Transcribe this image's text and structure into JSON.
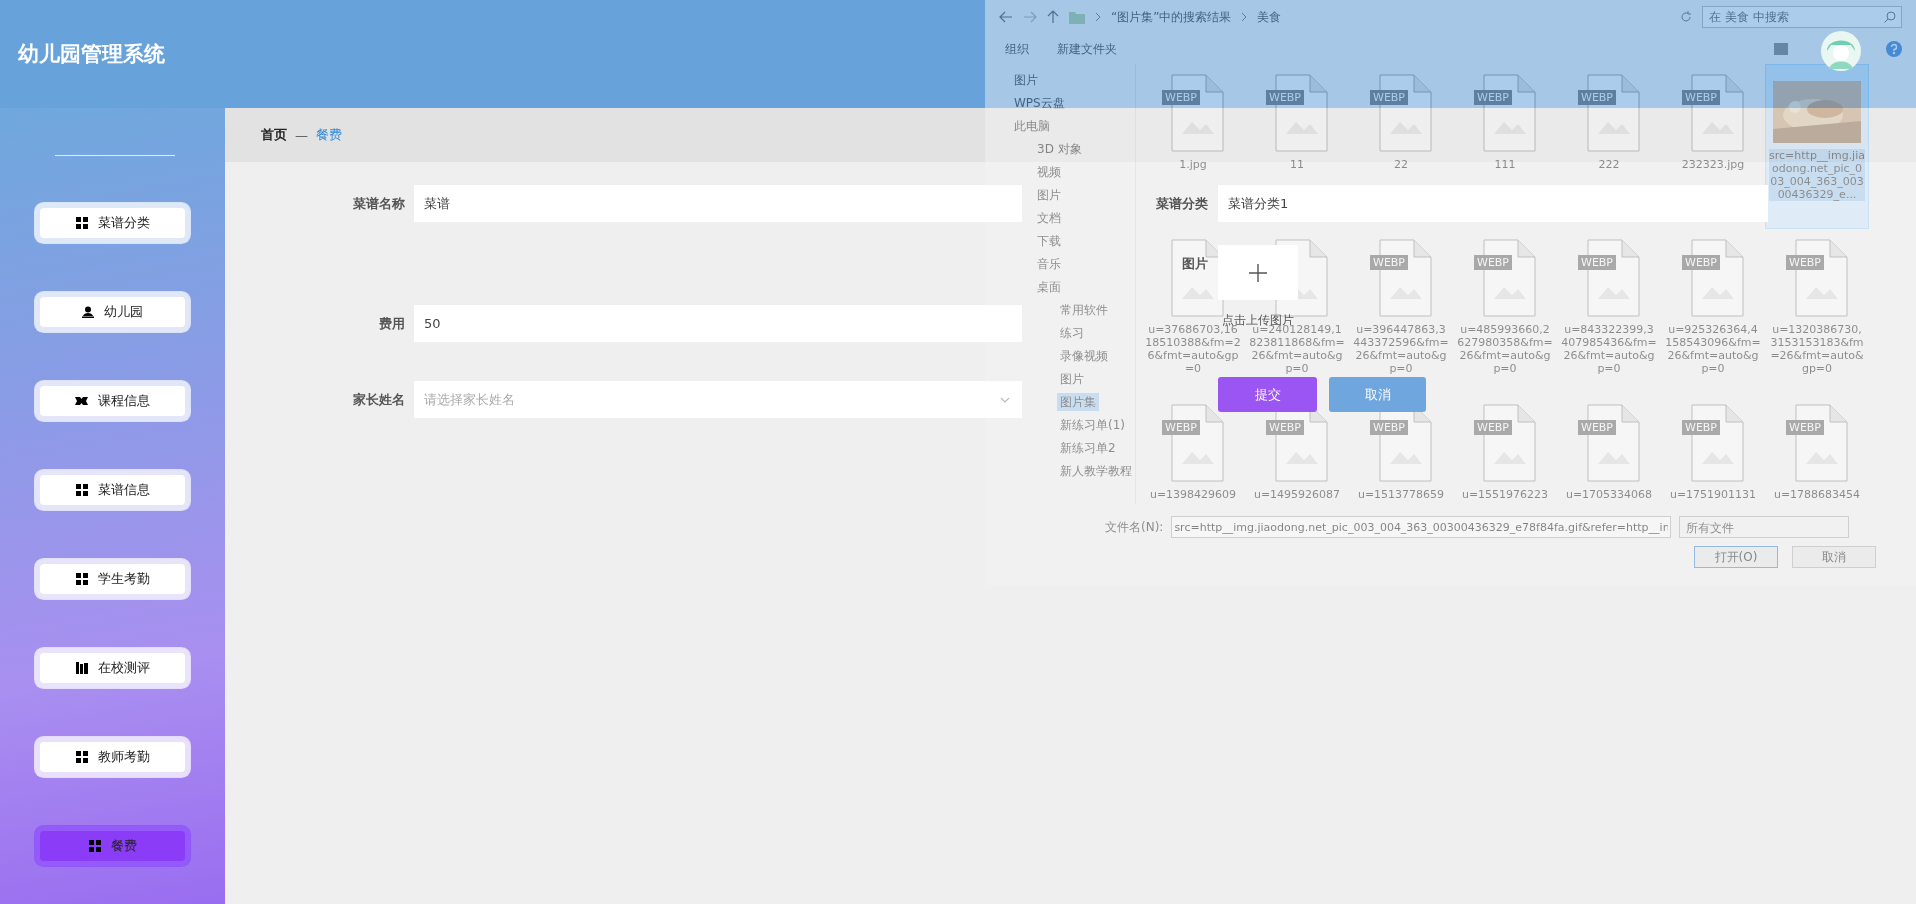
{
  "header": {
    "title": "幼儿园管理系统"
  },
  "sidebar": {
    "items": [
      {
        "label": "菜谱分类",
        "kind": "grid",
        "selected": false
      },
      {
        "label": "幼儿园",
        "kind": "person",
        "selected": false
      },
      {
        "label": "课程信息",
        "kind": "ticket",
        "selected": false
      },
      {
        "label": "菜谱信息",
        "kind": "grid",
        "selected": false
      },
      {
        "label": "学生考勤",
        "kind": "grid",
        "selected": false
      },
      {
        "label": "在校测评",
        "kind": "books",
        "selected": false
      },
      {
        "label": "教师考勤",
        "kind": "grid",
        "selected": false
      },
      {
        "label": "餐费",
        "kind": "grid",
        "selected": true
      }
    ]
  },
  "breadcrumb": {
    "home": "首页",
    "separator": "—",
    "current": "餐费"
  },
  "form": {
    "left": [
      {
        "label": "菜谱名称",
        "kind": "text",
        "value": "菜谱"
      },
      {
        "label": "费用",
        "kind": "text",
        "value": "50"
      },
      {
        "label": "家长姓名",
        "kind": "select",
        "placeholder": "请选择家长姓名"
      }
    ],
    "category": {
      "label": "菜谱分类",
      "value": "菜谱分类1"
    },
    "upload": {
      "label": "图片",
      "hint": "点击上传图片"
    },
    "buttons": [
      {
        "label": "提交",
        "kind": "primary"
      },
      {
        "label": "取消",
        "kind": "secondary"
      }
    ]
  },
  "file_dialog": {
    "path": [
      "“图片集”中的搜索结果",
      "美食"
    ],
    "search": {
      "placeholder": "在 美食 中搜索"
    },
    "toolbar": [
      "组织",
      "新建文件夹"
    ],
    "nav": [
      {
        "label": "图片",
        "selected": false
      },
      {
        "label": "WPS云盘",
        "selected": false
      },
      {
        "label": "此电脑",
        "selected": false,
        "children": [
          {
            "label": "3D 对象",
            "selected": false
          },
          {
            "label": "视频",
            "selected": false
          },
          {
            "label": "图片",
            "selected": false
          },
          {
            "label": "文档",
            "selected": false
          },
          {
            "label": "下载",
            "selected": false
          },
          {
            "label": "音乐",
            "selected": false
          },
          {
            "label": "桌面",
            "selected": false,
            "children": [
              {
                "label": "常用软件",
                "selected": false
              },
              {
                "label": "练习",
                "selected": false
              },
              {
                "label": "录像视频",
                "selected": false
              },
              {
                "label": "图片",
                "selected": false
              },
              {
                "label": "图片集",
                "selected": true
              },
              {
                "label": "新练习单(1)",
                "selected": false
              },
              {
                "label": "新练习单2",
                "selected": false
              },
              {
                "label": "新人教学教程",
                "selected": false
              }
            ]
          }
        ]
      }
    ],
    "files": [
      {
        "name": "1.jpg",
        "kind": "file",
        "badge": "WEBP",
        "selected": false
      },
      {
        "name": "11",
        "kind": "file",
        "badge": "WEBP",
        "selected": false
      },
      {
        "name": "22",
        "kind": "file",
        "badge": "WEBP",
        "selected": false
      },
      {
        "name": "111",
        "kind": "file",
        "badge": "WEBP",
        "selected": false
      },
      {
        "name": "222",
        "kind": "file",
        "badge": "WEBP",
        "selected": false
      },
      {
        "name": "232323.jpg",
        "kind": "file",
        "badge": "WEBP",
        "selected": false
      },
      {
        "name": "src=http__img.jiaodong.net_pic_003_004_363_00300436329_e...",
        "selected": true
      },
      {
        "name": "u=37686703,1618510388&fm=26&fmt=auto&gp=0",
        "kind": "file",
        "selected": false
      },
      {
        "name": "u=240128149,1823811868&fm=26&fmt=auto&gp=0",
        "kind": "file",
        "selected": false
      },
      {
        "name": "u=396447863,3443372596&fm=26&fmt=auto&gp=0",
        "kind": "file",
        "badge": "WEBP",
        "selected": false
      },
      {
        "name": "u=485993660,2627980358&fm=26&fmt=auto&gp=0",
        "kind": "file",
        "badge": "WEBP",
        "selected": false
      },
      {
        "name": "u=843322399,3407985436&fm=26&fmt=auto&gp=0",
        "kind": "file",
        "badge": "WEBP",
        "selected": false
      },
      {
        "name": "u=925326364,4158543096&fm=26&fmt=auto&gp=0",
        "kind": "file",
        "badge": "WEBP",
        "selected": false
      },
      {
        "name": "u=1320386730,3153153183&fm=26&fmt=auto&gp=0",
        "kind": "file",
        "badge": "WEBP",
        "selected": false
      },
      {
        "name": "u=1398429609",
        "kind": "file",
        "badge": "WEBP",
        "selected": false
      },
      {
        "name": "u=1495926087",
        "kind": "file",
        "badge": "WEBP",
        "selected": false
      },
      {
        "name": "u=1513778659",
        "kind": "file",
        "badge": "WEBP",
        "selected": false
      },
      {
        "name": "u=1551976223",
        "kind": "file",
        "badge": "WEBP",
        "selected": false
      },
      {
        "name": "u=1705334068",
        "kind": "file",
        "badge": "WEBP",
        "selected": false
      },
      {
        "name": "u=1751901131",
        "kind": "file",
        "badge": "WEBP",
        "selected": false
      },
      {
        "name": "u=1788683454",
        "kind": "file",
        "badge": "WEBP",
        "selected": false
      }
    ],
    "filename": {
      "label": "文件名(N):",
      "value": "src=http__img.jiaodong.net_pic_003_004_363_00300436329_e78f84fa.gif&refer=http__in"
    },
    "filter": "所有文件",
    "buttons": [
      "打开(O)",
      "取消"
    ]
  }
}
